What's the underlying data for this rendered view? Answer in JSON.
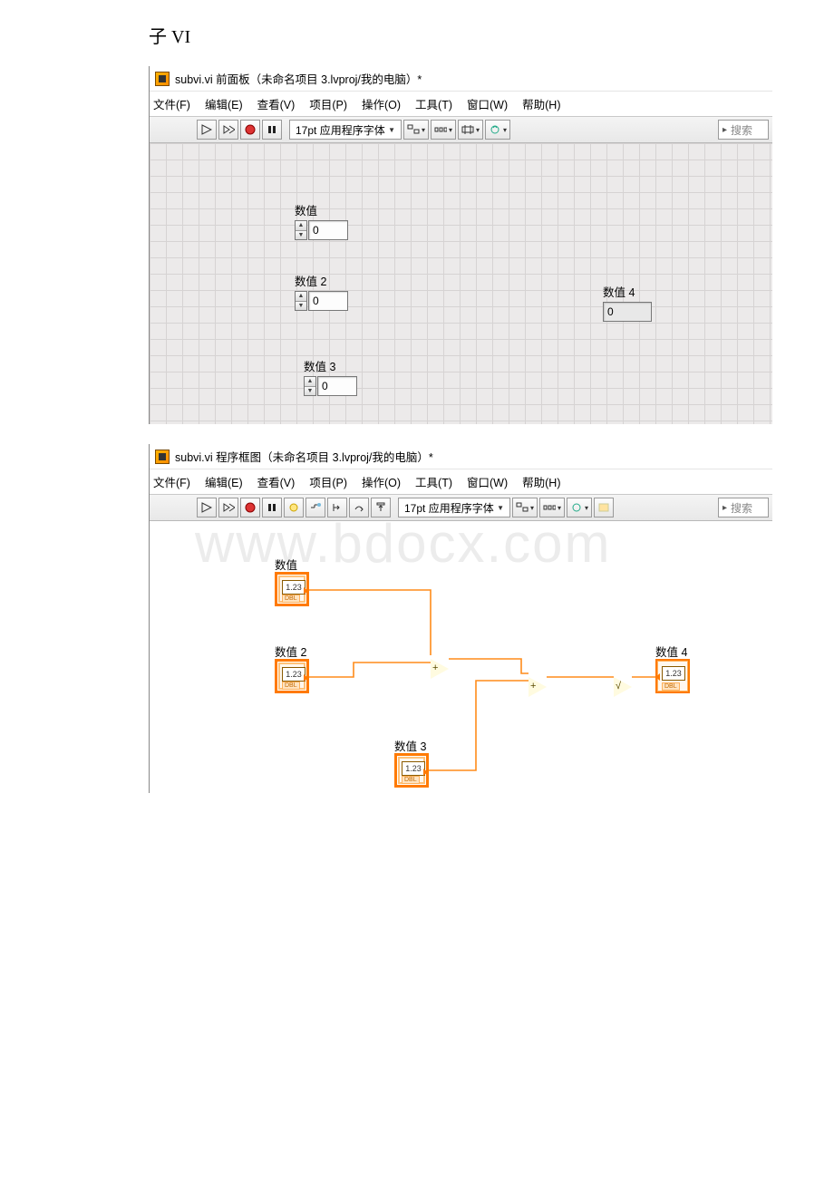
{
  "heading": "子 VI",
  "front_panel": {
    "title": "subvi.vi 前面板（未命名项目 3.lvproj/我的电脑）*",
    "menu": [
      "文件(F)",
      "编辑(E)",
      "查看(V)",
      "项目(P)",
      "操作(O)",
      "工具(T)",
      "窗口(W)",
      "帮助(H)"
    ],
    "font_label": "17pt 应用程序字体",
    "search_placeholder": "搜索",
    "controls": {
      "c1": {
        "label": "数值",
        "value": "0"
      },
      "c2": {
        "label": "数值 2",
        "value": "0"
      },
      "c3": {
        "label": "数值 3",
        "value": "0"
      },
      "ind": {
        "label": "数值 4",
        "value": "0"
      }
    }
  },
  "block_diagram": {
    "title": "subvi.vi 程序框图（未命名项目 3.lvproj/我的电脑）*",
    "menu": [
      "文件(F)",
      "编辑(E)",
      "查看(V)",
      "项目(P)",
      "操作(O)",
      "工具(T)",
      "窗口(W)",
      "帮助(H)"
    ],
    "font_label": "17pt 应用程序字体",
    "search_placeholder": "搜索",
    "nodes": {
      "n1": {
        "label": "数值",
        "term_text": "1.23",
        "type": "DBL"
      },
      "n2": {
        "label": "数值 2",
        "term_text": "1.23",
        "type": "DBL"
      },
      "n3": {
        "label": "数值 3",
        "term_text": "1.23",
        "type": "DBL"
      },
      "n4": {
        "label": "数值 4",
        "term_text": "1.23",
        "type": "DBL"
      }
    },
    "ops": {
      "add1": "+",
      "add2": "+",
      "sqrt": "√"
    }
  },
  "watermark": "www.bdocx.com"
}
